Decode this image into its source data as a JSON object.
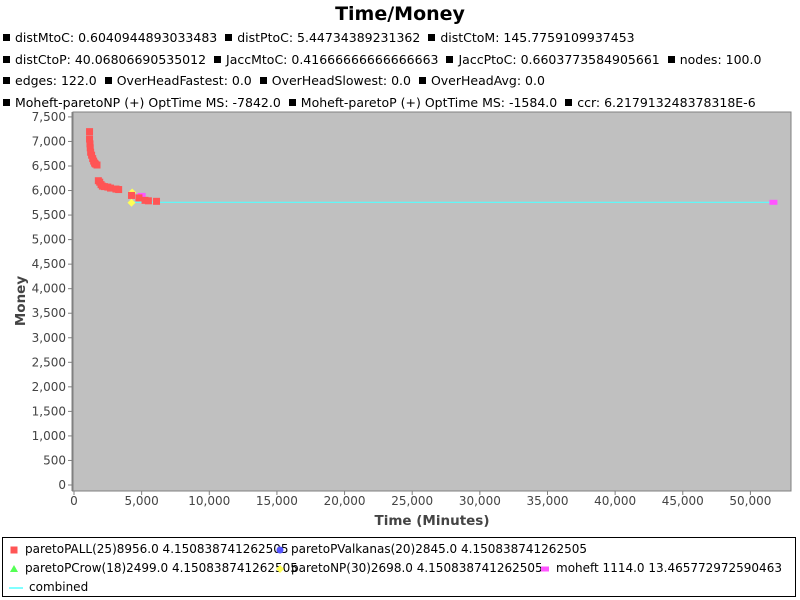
{
  "chart_data": {
    "type": "scatter",
    "title": "Time/Money",
    "subtitle_stats": [
      "distMtoC: 0.6040944893033483",
      "distPtoC: 5.44734389231362",
      "distCtoM: 145.7759109937453",
      "distCtoP: 40.06806690535012",
      "JaccMtoC: 0.41666666666666663",
      "JaccPtoC: 0.6603773584905661",
      "nodes: 100.0",
      "edges: 122.0",
      "OverHeadFastest: 0.0",
      "OverHeadSlowest: 0.0",
      "OverHeadAvg: 0.0",
      "Moheft-paretoNP (+) OptTime MS: -7842.0",
      "Moheft-paretoP (+) OptTime MS: -1584.0",
      "ccr: 6.217913248378318E-6"
    ],
    "xlabel": "Time (Minutes)",
    "ylabel": "Money",
    "xlim": [
      0,
      53000
    ],
    "ylim": [
      0,
      7600
    ],
    "x_ticks": [
      0,
      5000,
      10000,
      15000,
      20000,
      25000,
      30000,
      35000,
      40000,
      45000,
      50000
    ],
    "y_ticks": [
      0,
      500,
      1000,
      1500,
      2000,
      2500,
      3000,
      3500,
      4000,
      4500,
      5000,
      5500,
      6000,
      6500,
      7000,
      7500
    ],
    "grid": false,
    "legend_position": "bottom",
    "series": [
      {
        "name": "paretoPALL(25)8956.0 4.150838741262505",
        "marker": "square",
        "color": "#ff5555",
        "points": [
          [
            1150,
            7200
          ],
          [
            1150,
            7050
          ],
          [
            1180,
            6950
          ],
          [
            1200,
            6870
          ],
          [
            1230,
            6780
          ],
          [
            1300,
            6720
          ],
          [
            1380,
            6650
          ],
          [
            1450,
            6600
          ],
          [
            1520,
            6560
          ],
          [
            1580,
            6540
          ],
          [
            1700,
            6520
          ],
          [
            1800,
            6200
          ],
          [
            1900,
            6170
          ],
          [
            2000,
            6120
          ],
          [
            2100,
            6090
          ],
          [
            2250,
            6080
          ],
          [
            2500,
            6070
          ],
          [
            2700,
            6050
          ],
          [
            3100,
            6030
          ],
          [
            3300,
            6020
          ],
          [
            4250,
            5900
          ],
          [
            4800,
            5850
          ],
          [
            5250,
            5800
          ],
          [
            5500,
            5790
          ],
          [
            6100,
            5780
          ]
        ]
      },
      {
        "name": "paretoPValkanas(20)2845.0 4.150838741262505",
        "marker": "circle",
        "color": "#5555ff",
        "points": []
      },
      {
        "name": "paretoPCrow(18)2499.0 4.150838741262505",
        "marker": "triangle",
        "color": "#55ff55",
        "points": []
      },
      {
        "name": "paretoNP(30)2698.0 4.150838741262505",
        "marker": "diamond",
        "color": "#ffff55",
        "points": [
          [
            4250,
            5750
          ],
          [
            4300,
            5960
          ]
        ]
      },
      {
        "name": "moheft 1114.0 13.465772972590463",
        "marker": "rect",
        "color": "#ff55ff",
        "points": [
          [
            5000,
            5900
          ],
          [
            51700,
            5760
          ]
        ]
      },
      {
        "name": "combined",
        "marker": "line",
        "color": "#55ffff",
        "points": [
          [
            4250,
            5760
          ],
          [
            51700,
            5760
          ]
        ]
      }
    ]
  }
}
